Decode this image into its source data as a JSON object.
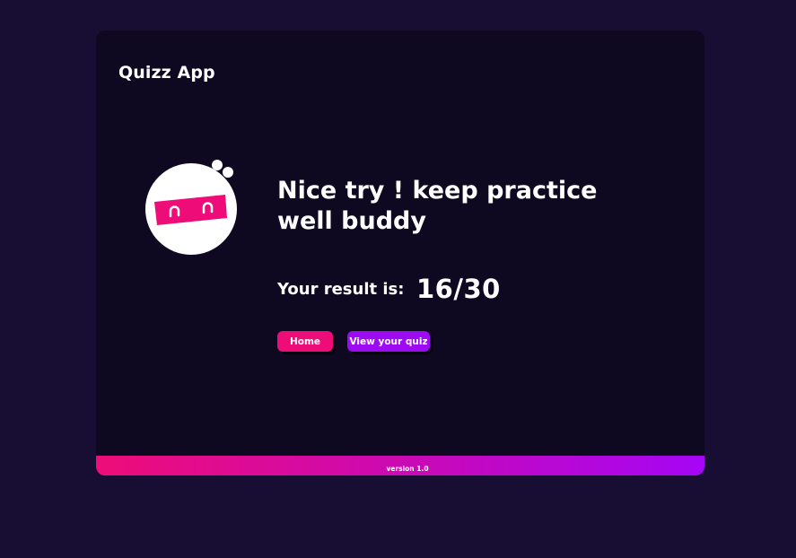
{
  "header": {
    "app_title": "Quizz App"
  },
  "result": {
    "message": "Nice try ! keep practice well buddy",
    "score_label": "Your result is:",
    "score": "16/30"
  },
  "actions": {
    "home_label": "Home",
    "view_quiz_label": "View your quiz"
  },
  "footer": {
    "version": "version 1.0"
  },
  "theme": {
    "page_background": "#180d32",
    "card_background": "#0e0921",
    "accent_pink": "#ee0d78",
    "accent_purple": "#9c0bf2",
    "mascot_icon": "ninja-mascot-icon"
  }
}
